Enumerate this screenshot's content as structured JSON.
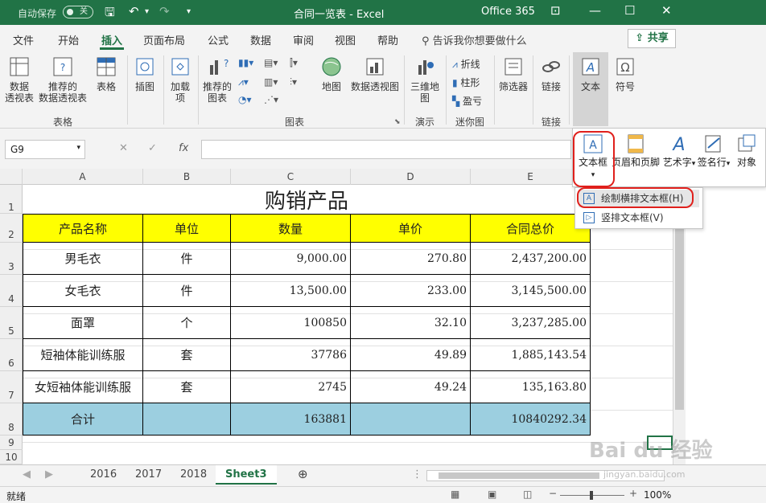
{
  "titlebar": {
    "autosave": "自动保存",
    "autosave_state": "关",
    "doc_title": "合同一览表 - Excel",
    "office": "Office 365"
  },
  "tabs": [
    "文件",
    "开始",
    "插入",
    "页面布局",
    "公式",
    "数据",
    "审阅",
    "视图",
    "帮助"
  ],
  "active_tab": "插入",
  "tell_me": "告诉我你想要做什么",
  "share": "共享",
  "ribbon": {
    "pivot": "数据\n透视表",
    "recommended_pivot": "推荐的\n数据透视表",
    "table": "表格",
    "illustrations": "插图",
    "addins": "加载\n项",
    "recommended_charts": "推荐的\n图表",
    "map": "地图",
    "pivot_chart": "数据透视图",
    "3d_map": "三维地\n图",
    "spark_line": "折线",
    "spark_column": "柱形",
    "spark_winloss": "盈亏",
    "filter": "筛选器",
    "link": "链接",
    "text": "文本",
    "symbol": "符号",
    "groups": {
      "tables": "表格",
      "charts": "图表",
      "tours": "演示",
      "sparklines": "迷你图",
      "links": "链接"
    }
  },
  "formula_bar": {
    "name_box": "G9",
    "fx": "fx"
  },
  "text_panel": {
    "items": [
      "文本框",
      "页眉和页脚",
      "艺术字",
      "签名行",
      "对象"
    ]
  },
  "textbox_menu": {
    "items": [
      "绘制横排文本框(H)",
      "竖排文本框(V)"
    ]
  },
  "columns": [
    "A",
    "B",
    "C",
    "D",
    "E"
  ],
  "rows": [
    "1",
    "2",
    "3",
    "4",
    "5",
    "6",
    "7",
    "8",
    "9",
    "10"
  ],
  "sheet": {
    "title": "购销产品",
    "headers": [
      "产品名称",
      "单位",
      "数量",
      "单价",
      "合同总价"
    ],
    "data": [
      [
        "男毛衣",
        "件",
        "9,000.00",
        "270.80",
        "2,437,200.00"
      ],
      [
        "女毛衣",
        "件",
        "13,500.00",
        "233.00",
        "3,145,500.00"
      ],
      [
        "面罩",
        "个",
        "100850",
        "32.10",
        "3,237,285.00"
      ],
      [
        "短袖体能训练服",
        "套",
        "37786",
        "49.89",
        "1,885,143.54"
      ],
      [
        "女短袖体能训练服",
        "套",
        "2745",
        "49.24",
        "135,163.80"
      ]
    ],
    "total": [
      "合计",
      "",
      "163881",
      "",
      "10840292.34"
    ]
  },
  "sheet_tabs": [
    "2016",
    "2017",
    "2018",
    "Sheet3"
  ],
  "active_sheet": "Sheet3",
  "status": {
    "ready": "就绪",
    "zoom": "100%"
  },
  "watermark": "Bai du 经验",
  "watermark_url": "jingyan.baidu.com",
  "colors": {
    "excel_green": "#217346",
    "header_fill": "#ffff00",
    "total_fill": "#9ccfe0",
    "highlight_red": "#e0201c"
  }
}
